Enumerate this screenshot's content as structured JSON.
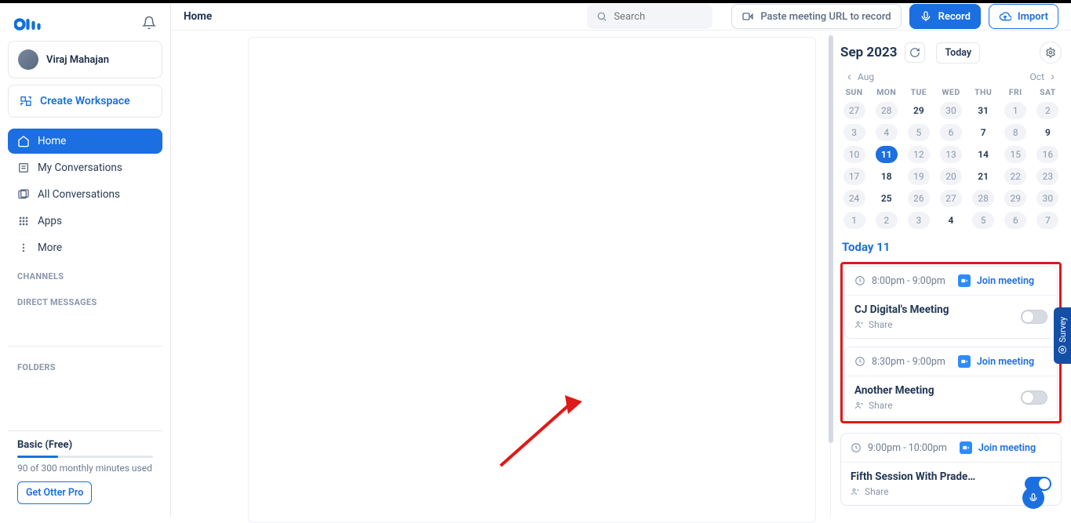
{
  "header": {
    "page_title": "Home"
  },
  "search": {
    "placeholder": "Search"
  },
  "actions": {
    "paste_label": "Paste meeting URL to record",
    "record_label": "Record",
    "import_label": "Import"
  },
  "user": {
    "name": "Viraj Mahajan"
  },
  "workspace": {
    "create_label": "Create Workspace"
  },
  "nav": {
    "home": "Home",
    "my_conversations": "My Conversations",
    "all_conversations": "All Conversations",
    "apps": "Apps",
    "more": "More"
  },
  "sections": {
    "channels": "CHANNELS",
    "direct_messages": "DIRECT MESSAGES",
    "folders": "FOLDERS"
  },
  "plan": {
    "title": "Basic (Free)",
    "usage_text": "90 of 300 monthly minutes used",
    "get_pro": "Get Otter Pro"
  },
  "calendar": {
    "month_label": "Sep 2023",
    "today_label": "Today",
    "prev_label": "Aug",
    "next_label": "Oct",
    "dow": [
      "SUN",
      "MON",
      "TUE",
      "WED",
      "THU",
      "FRI",
      "SAT"
    ],
    "weeks": [
      [
        {
          "d": "27",
          "m": "prev"
        },
        {
          "d": "28",
          "m": "prev"
        },
        {
          "d": "29",
          "m": "cur"
        },
        {
          "d": "30",
          "m": "dim"
        },
        {
          "d": "31",
          "m": "cur"
        },
        {
          "d": "1",
          "m": "dim"
        },
        {
          "d": "2",
          "m": "dim"
        }
      ],
      [
        {
          "d": "3",
          "m": "dim"
        },
        {
          "d": "4",
          "m": "dim"
        },
        {
          "d": "5",
          "m": "dim"
        },
        {
          "d": "6",
          "m": "dim"
        },
        {
          "d": "7",
          "m": "cur"
        },
        {
          "d": "8",
          "m": "dim"
        },
        {
          "d": "9",
          "m": "cur"
        }
      ],
      [
        {
          "d": "10",
          "m": "dim"
        },
        {
          "d": "11",
          "m": "sel"
        },
        {
          "d": "12",
          "m": "dim"
        },
        {
          "d": "13",
          "m": "dim"
        },
        {
          "d": "14",
          "m": "cur"
        },
        {
          "d": "15",
          "m": "dim"
        },
        {
          "d": "16",
          "m": "dim"
        }
      ],
      [
        {
          "d": "17",
          "m": "dim"
        },
        {
          "d": "18",
          "m": "cur"
        },
        {
          "d": "19",
          "m": "dim"
        },
        {
          "d": "20",
          "m": "dim"
        },
        {
          "d": "21",
          "m": "cur"
        },
        {
          "d": "22",
          "m": "dim"
        },
        {
          "d": "23",
          "m": "dim"
        }
      ],
      [
        {
          "d": "24",
          "m": "dim"
        },
        {
          "d": "25",
          "m": "cur"
        },
        {
          "d": "26",
          "m": "dim"
        },
        {
          "d": "27",
          "m": "dim"
        },
        {
          "d": "28",
          "m": "dim"
        },
        {
          "d": "29",
          "m": "dim"
        },
        {
          "d": "30",
          "m": "dim"
        }
      ],
      [
        {
          "d": "1",
          "m": "next"
        },
        {
          "d": "2",
          "m": "next"
        },
        {
          "d": "3",
          "m": "next"
        },
        {
          "d": "4",
          "m": "cur"
        },
        {
          "d": "5",
          "m": "next"
        },
        {
          "d": "6",
          "m": "next"
        },
        {
          "d": "7",
          "m": "next"
        }
      ]
    ]
  },
  "today_section": {
    "title": "Today 11"
  },
  "meetings": [
    {
      "time": "8:00pm - 9:00pm",
      "join": "Join meeting",
      "title": "CJ Digital's Meeting",
      "share": "Share",
      "toggle_on": false
    },
    {
      "time": "8:30pm - 9:00pm",
      "join": "Join meeting",
      "title": "Another Meeting",
      "share": "Share",
      "toggle_on": false
    },
    {
      "time": "9:00pm - 10:00pm",
      "join": "Join meeting",
      "title": "Fifth Session With Prade…",
      "share": "Share",
      "toggle_on": true
    }
  ],
  "survey": {
    "label": "Survey"
  }
}
